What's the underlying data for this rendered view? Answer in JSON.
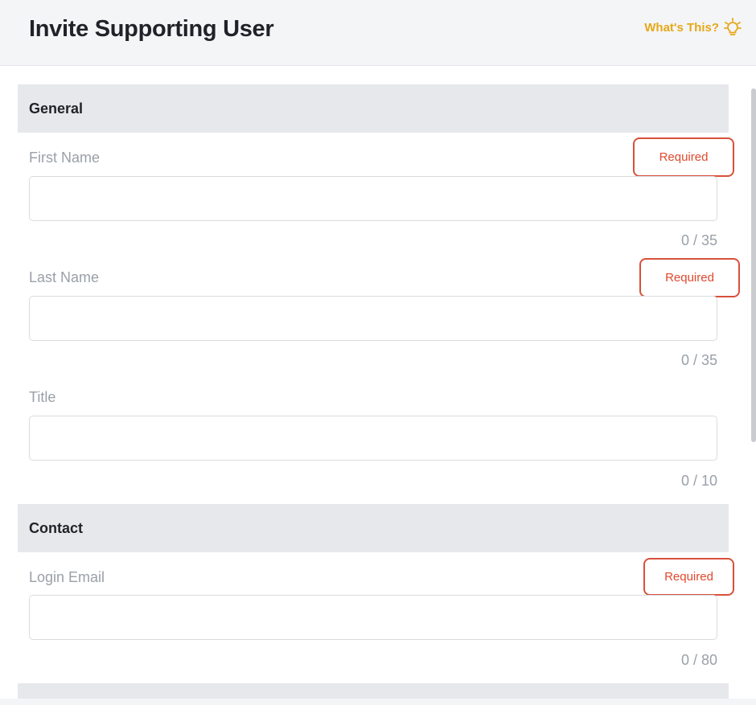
{
  "header": {
    "title": "Invite Supporting User",
    "help_label": "What's This?",
    "help_icon": "lightbulb-icon",
    "accent": "#e6a817"
  },
  "sections": {
    "general": {
      "title": "General",
      "first_name": {
        "label": "First Name",
        "required": "Required",
        "value": "",
        "counter": "0 / 35"
      },
      "last_name": {
        "label": "Last Name",
        "required": "Required",
        "value": "",
        "counter": "0 / 35"
      },
      "title_field": {
        "label": "Title",
        "value": "",
        "counter": "0 / 10"
      }
    },
    "contact": {
      "title": "Contact",
      "login_email": {
        "label": "Login Email",
        "required": "Required",
        "value": "",
        "counter": "0 / 80"
      }
    }
  },
  "colors": {
    "required": "#e0492d",
    "section_bg": "#e7e8eb",
    "label": "#9aa0a8"
  }
}
